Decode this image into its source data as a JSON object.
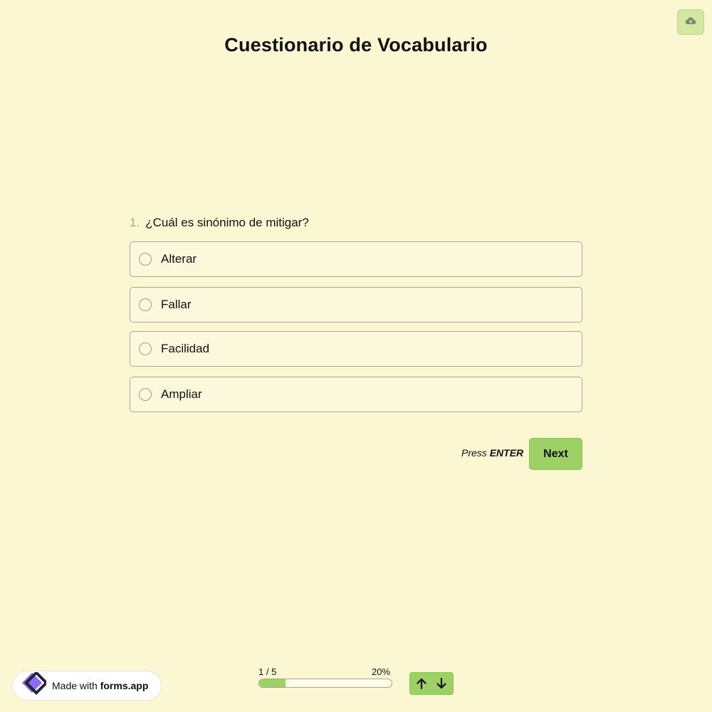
{
  "header": {
    "title": "Cuestionario de Vocabulario",
    "cloud_icon": "cloud-upload-icon"
  },
  "question": {
    "number": "1.",
    "text": "¿Cuál es sinónimo de mitigar?",
    "options": [
      {
        "label": "Alterar",
        "selected": false
      },
      {
        "label": "Fallar",
        "selected": false
      },
      {
        "label": "Facilidad",
        "selected": false
      },
      {
        "label": "Ampliar",
        "selected": false
      }
    ]
  },
  "actions": {
    "press_prefix": "Press",
    "press_key": "ENTER",
    "next_label": "Next"
  },
  "footer": {
    "badge_prefix": "Made with",
    "badge_brand": "forms.app",
    "progress_count": "1 / 5",
    "progress_percent_label": "20%",
    "progress_fraction": 0.2,
    "up_icon": "arrow-up-icon",
    "down_icon": "arrow-down-icon"
  },
  "colors": {
    "background": "#faf7d2",
    "accent": "#9dd165",
    "option_border": "#a5a59a"
  }
}
